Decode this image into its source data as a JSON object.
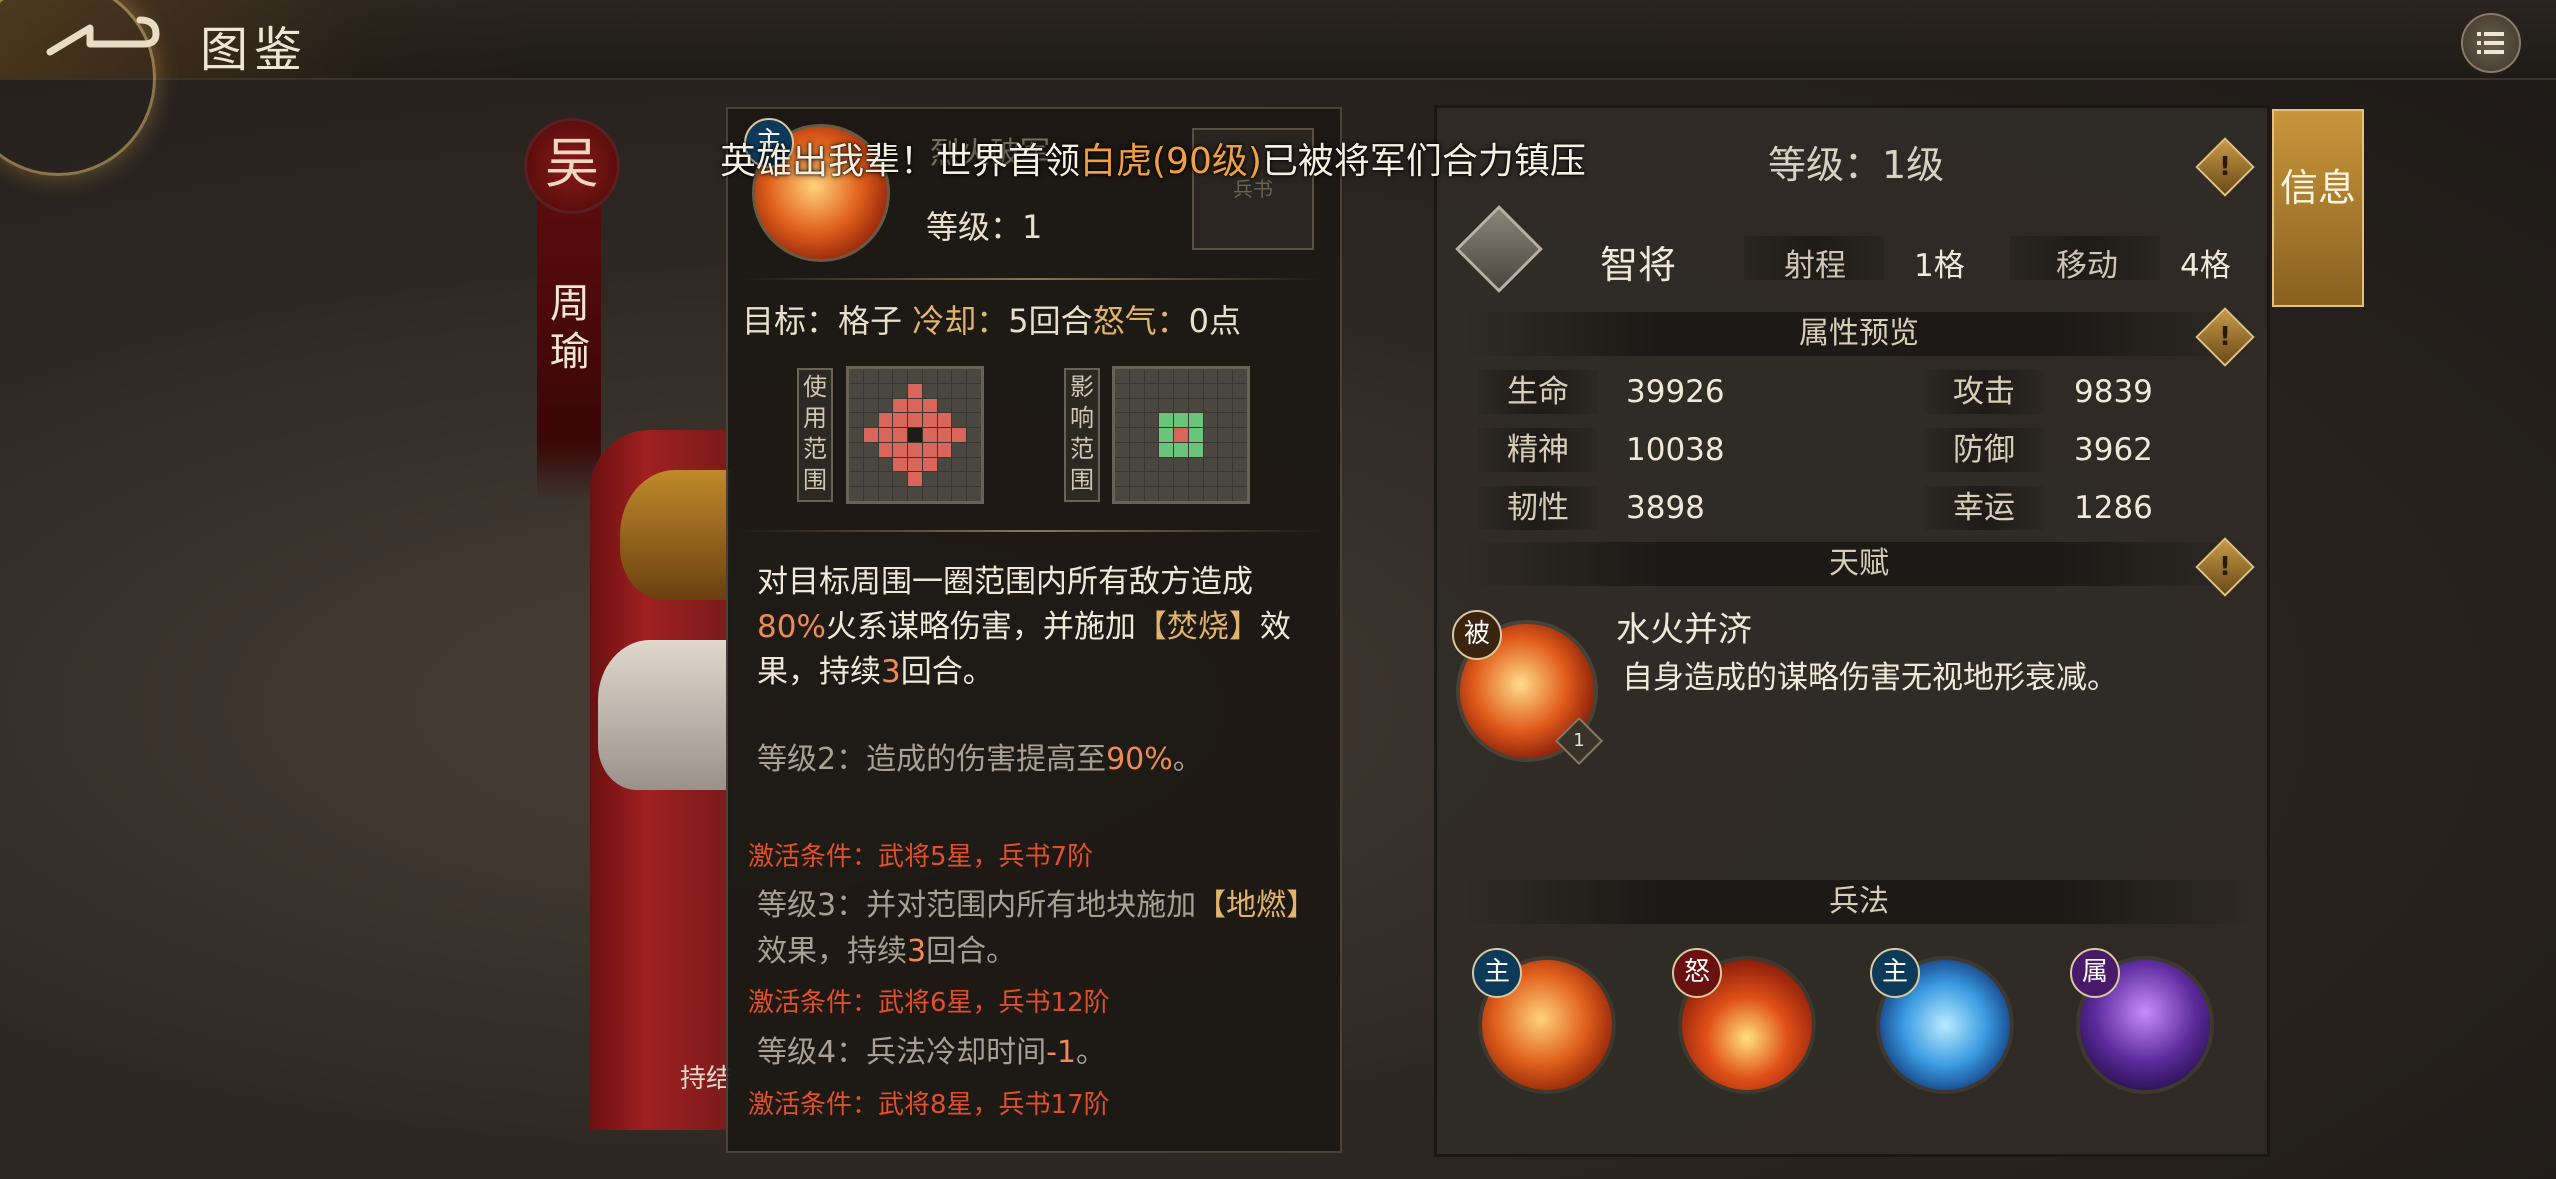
{
  "header": {
    "title": "图鉴"
  },
  "hero": {
    "faction": "吴",
    "name": "周瑜",
    "caption": "持结"
  },
  "announcement": {
    "prefix": "英雄出我辈！世界首领",
    "boss": "白虎(90级)",
    "suffix": "已被将军们合力镇压"
  },
  "skill": {
    "ghost_name": "烈火破军",
    "side_card_text": "兵书",
    "level": "等级：1",
    "target_label": "目标：",
    "target_value": "格子",
    "cooldown_label": "冷却：",
    "cooldown_value": "5回合",
    "rage_label": "怒气：",
    "rage_value": "0点",
    "use_range_label": "使用范围",
    "effect_range_label": "影响范围",
    "desc_1": "对目标周围一圈范围内所有敌方造成",
    "desc_pct": "80%",
    "desc_2": "火系谋略伤害，并施加",
    "desc_bracket": "【焚烧】",
    "desc_3": "效果，持续",
    "desc_turns": "3",
    "desc_4": "回合。",
    "levels": [
      {
        "text": "等级2：造成的伤害提高至",
        "value": "90%",
        "tail": "。",
        "condition": "激活条件：武将5星，兵书7阶"
      },
      {
        "text": "等级3：并对范围内所有地块施加",
        "bracket": "【地燃】",
        "mid": "效果，持续",
        "turns": "3",
        "tail": "回合。",
        "condition": "激活条件：武将6星，兵书12阶"
      },
      {
        "text": "等级4：兵法冷却时间",
        "value": "-1",
        "tail": "。",
        "condition": "激活条件：武将8星，兵书17阶"
      }
    ],
    "tag": "主"
  },
  "info": {
    "level": "等级：1级",
    "tab": "信息",
    "class_name": "智将",
    "range_label": "射程",
    "range_value": "1格",
    "move_label": "移动",
    "move_value": "4格",
    "attr_header": "属性预览",
    "stats": [
      {
        "label": "生命",
        "value": "39926"
      },
      {
        "label": "攻击",
        "value": "9839"
      },
      {
        "label": "精神",
        "value": "10038"
      },
      {
        "label": "防御",
        "value": "3962"
      },
      {
        "label": "韧性",
        "value": "3898"
      },
      {
        "label": "幸运",
        "value": "1286"
      }
    ],
    "talent_header": "天赋",
    "talent_tag": "被",
    "talent_count": "1",
    "talent_name": "水火并济",
    "talent_desc": "自身造成的谋略伤害无视地形衰减。",
    "tactics_header": "兵法",
    "tactics": [
      {
        "tag": "主"
      },
      {
        "tag": "怒"
      },
      {
        "tag": "主"
      },
      {
        "tag": "属"
      }
    ],
    "warn_glyph": "!"
  }
}
